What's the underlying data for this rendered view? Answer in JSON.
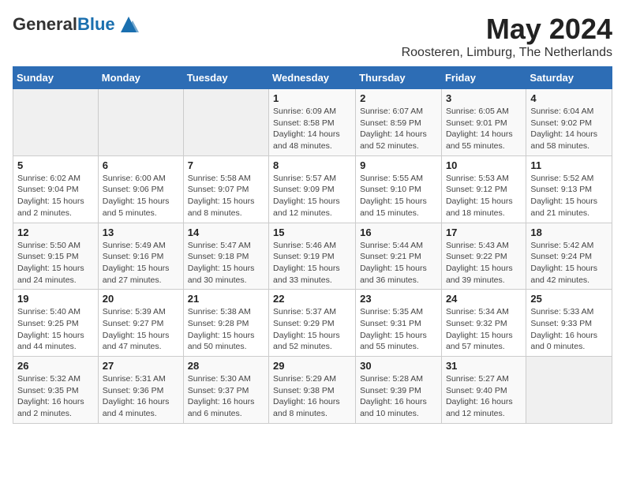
{
  "header": {
    "logo_general": "General",
    "logo_blue": "Blue",
    "month_year": "May 2024",
    "location": "Roosteren, Limburg, The Netherlands"
  },
  "days_of_week": [
    "Sunday",
    "Monday",
    "Tuesday",
    "Wednesday",
    "Thursday",
    "Friday",
    "Saturday"
  ],
  "weeks": [
    [
      {
        "day": "",
        "info": ""
      },
      {
        "day": "",
        "info": ""
      },
      {
        "day": "",
        "info": ""
      },
      {
        "day": "1",
        "info": "Sunrise: 6:09 AM\nSunset: 8:58 PM\nDaylight: 14 hours\nand 48 minutes."
      },
      {
        "day": "2",
        "info": "Sunrise: 6:07 AM\nSunset: 8:59 PM\nDaylight: 14 hours\nand 52 minutes."
      },
      {
        "day": "3",
        "info": "Sunrise: 6:05 AM\nSunset: 9:01 PM\nDaylight: 14 hours\nand 55 minutes."
      },
      {
        "day": "4",
        "info": "Sunrise: 6:04 AM\nSunset: 9:02 PM\nDaylight: 14 hours\nand 58 minutes."
      }
    ],
    [
      {
        "day": "5",
        "info": "Sunrise: 6:02 AM\nSunset: 9:04 PM\nDaylight: 15 hours\nand 2 minutes."
      },
      {
        "day": "6",
        "info": "Sunrise: 6:00 AM\nSunset: 9:06 PM\nDaylight: 15 hours\nand 5 minutes."
      },
      {
        "day": "7",
        "info": "Sunrise: 5:58 AM\nSunset: 9:07 PM\nDaylight: 15 hours\nand 8 minutes."
      },
      {
        "day": "8",
        "info": "Sunrise: 5:57 AM\nSunset: 9:09 PM\nDaylight: 15 hours\nand 12 minutes."
      },
      {
        "day": "9",
        "info": "Sunrise: 5:55 AM\nSunset: 9:10 PM\nDaylight: 15 hours\nand 15 minutes."
      },
      {
        "day": "10",
        "info": "Sunrise: 5:53 AM\nSunset: 9:12 PM\nDaylight: 15 hours\nand 18 minutes."
      },
      {
        "day": "11",
        "info": "Sunrise: 5:52 AM\nSunset: 9:13 PM\nDaylight: 15 hours\nand 21 minutes."
      }
    ],
    [
      {
        "day": "12",
        "info": "Sunrise: 5:50 AM\nSunset: 9:15 PM\nDaylight: 15 hours\nand 24 minutes."
      },
      {
        "day": "13",
        "info": "Sunrise: 5:49 AM\nSunset: 9:16 PM\nDaylight: 15 hours\nand 27 minutes."
      },
      {
        "day": "14",
        "info": "Sunrise: 5:47 AM\nSunset: 9:18 PM\nDaylight: 15 hours\nand 30 minutes."
      },
      {
        "day": "15",
        "info": "Sunrise: 5:46 AM\nSunset: 9:19 PM\nDaylight: 15 hours\nand 33 minutes."
      },
      {
        "day": "16",
        "info": "Sunrise: 5:44 AM\nSunset: 9:21 PM\nDaylight: 15 hours\nand 36 minutes."
      },
      {
        "day": "17",
        "info": "Sunrise: 5:43 AM\nSunset: 9:22 PM\nDaylight: 15 hours\nand 39 minutes."
      },
      {
        "day": "18",
        "info": "Sunrise: 5:42 AM\nSunset: 9:24 PM\nDaylight: 15 hours\nand 42 minutes."
      }
    ],
    [
      {
        "day": "19",
        "info": "Sunrise: 5:40 AM\nSunset: 9:25 PM\nDaylight: 15 hours\nand 44 minutes."
      },
      {
        "day": "20",
        "info": "Sunrise: 5:39 AM\nSunset: 9:27 PM\nDaylight: 15 hours\nand 47 minutes."
      },
      {
        "day": "21",
        "info": "Sunrise: 5:38 AM\nSunset: 9:28 PM\nDaylight: 15 hours\nand 50 minutes."
      },
      {
        "day": "22",
        "info": "Sunrise: 5:37 AM\nSunset: 9:29 PM\nDaylight: 15 hours\nand 52 minutes."
      },
      {
        "day": "23",
        "info": "Sunrise: 5:35 AM\nSunset: 9:31 PM\nDaylight: 15 hours\nand 55 minutes."
      },
      {
        "day": "24",
        "info": "Sunrise: 5:34 AM\nSunset: 9:32 PM\nDaylight: 15 hours\nand 57 minutes."
      },
      {
        "day": "25",
        "info": "Sunrise: 5:33 AM\nSunset: 9:33 PM\nDaylight: 16 hours\nand 0 minutes."
      }
    ],
    [
      {
        "day": "26",
        "info": "Sunrise: 5:32 AM\nSunset: 9:35 PM\nDaylight: 16 hours\nand 2 minutes."
      },
      {
        "day": "27",
        "info": "Sunrise: 5:31 AM\nSunset: 9:36 PM\nDaylight: 16 hours\nand 4 minutes."
      },
      {
        "day": "28",
        "info": "Sunrise: 5:30 AM\nSunset: 9:37 PM\nDaylight: 16 hours\nand 6 minutes."
      },
      {
        "day": "29",
        "info": "Sunrise: 5:29 AM\nSunset: 9:38 PM\nDaylight: 16 hours\nand 8 minutes."
      },
      {
        "day": "30",
        "info": "Sunrise: 5:28 AM\nSunset: 9:39 PM\nDaylight: 16 hours\nand 10 minutes."
      },
      {
        "day": "31",
        "info": "Sunrise: 5:27 AM\nSunset: 9:40 PM\nDaylight: 16 hours\nand 12 minutes."
      },
      {
        "day": "",
        "info": ""
      }
    ]
  ]
}
